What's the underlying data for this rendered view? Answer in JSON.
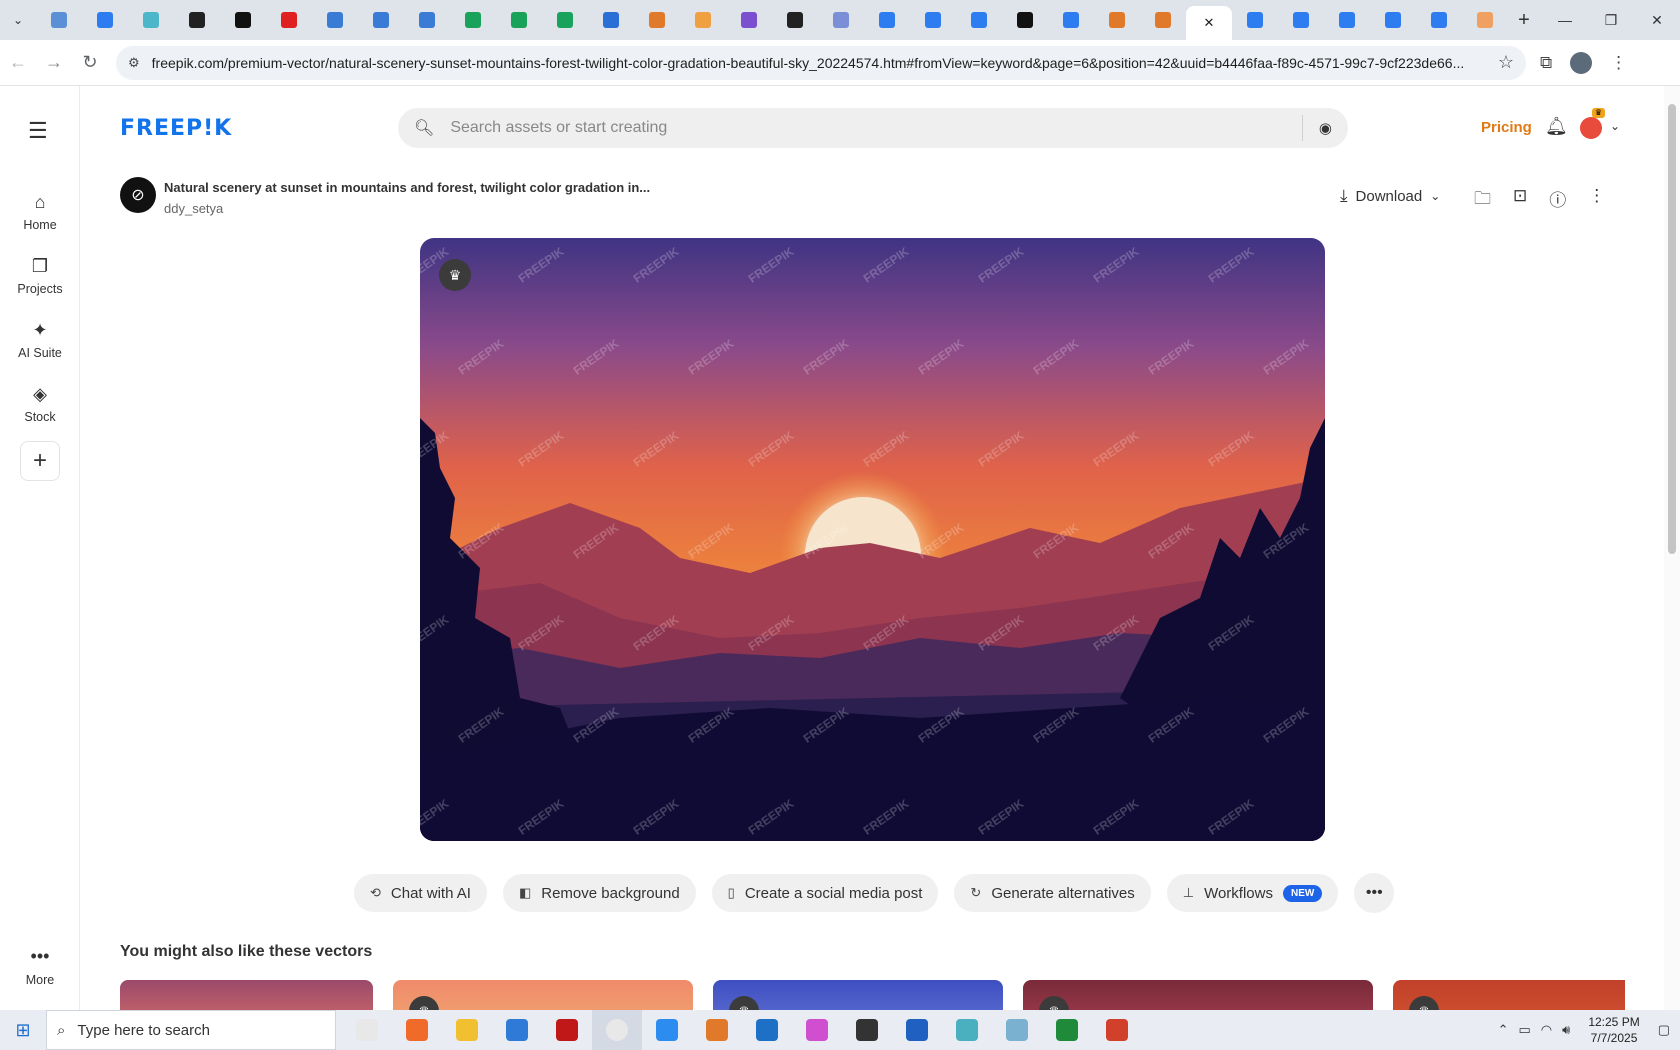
{
  "browser": {
    "tabs_count": 31,
    "url": "freepik.com/premium-vector/natural-scenery-sunset-mountains-forest-twilight-color-gradation-beautiful-sky_20224574.htm#fromView=keyword&page=6&position=42&uuid=b4446faa-f89c-4571-99c7-9cf223de66..."
  },
  "sidebar": {
    "items": [
      {
        "icon": "home-icon",
        "label": "Home"
      },
      {
        "icon": "projects-icon",
        "label": "Projects"
      },
      {
        "icon": "ai-sparkle-icon",
        "label": "AI Suite"
      },
      {
        "icon": "stock-icon",
        "label": "Stock"
      }
    ],
    "more_label": "More"
  },
  "header": {
    "logo": "FREEP!K",
    "search_placeholder": "Search assets or start creating",
    "pricing_label": "Pricing"
  },
  "asset": {
    "title": "Natural scenery at sunset in mountains and forest, twilight color gradation in...",
    "author": "ddy_setya",
    "download_label": "Download",
    "watermark": "FREEPIK"
  },
  "actions": [
    {
      "icon": "chat-icon",
      "label": "Chat with AI"
    },
    {
      "icon": "remove-bg-icon",
      "label": "Remove background"
    },
    {
      "icon": "phone-icon",
      "label": "Create a social media post"
    },
    {
      "icon": "refresh-icon",
      "label": "Generate alternatives"
    },
    {
      "icon": "workflow-icon",
      "label": "Workflows",
      "badge": "NEW"
    }
  ],
  "related": {
    "title": "You might also like these vectors"
  },
  "taskbar": {
    "search_placeholder": "Type here to search",
    "time": "12:25 PM",
    "date": "7/7/2025"
  },
  "colors": {
    "brand": "#1273eb",
    "pricing": "#e07a13",
    "new_badge": "#1e64e8"
  }
}
